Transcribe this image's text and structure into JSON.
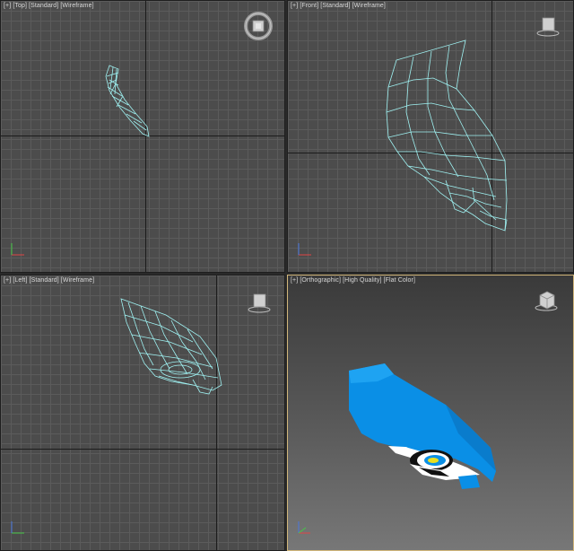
{
  "viewports": {
    "top": {
      "label": "[+] [Top] [Standard] [Wireframe]"
    },
    "front": {
      "label": "[+] [Front] [Standard] [Wireframe]"
    },
    "left": {
      "label": "[+] [Left] [Standard] [Wireframe]"
    },
    "persp": {
      "label": "[+] [Orthographic] [High Quality] [Flat Color]"
    }
  },
  "colors": {
    "wireframe": "#9ff2f2",
    "model_fill": "#0a8fe6",
    "active_border": "#d1b67a",
    "grid_line": "#5b5b5b",
    "axis_line": "#1c1c1c"
  },
  "icons": {
    "nav_cube": "viewcube-icon",
    "steering_wheel": "steering-wheel-icon",
    "axis_gizmo": "xyz-axis-gizmo-icon"
  }
}
